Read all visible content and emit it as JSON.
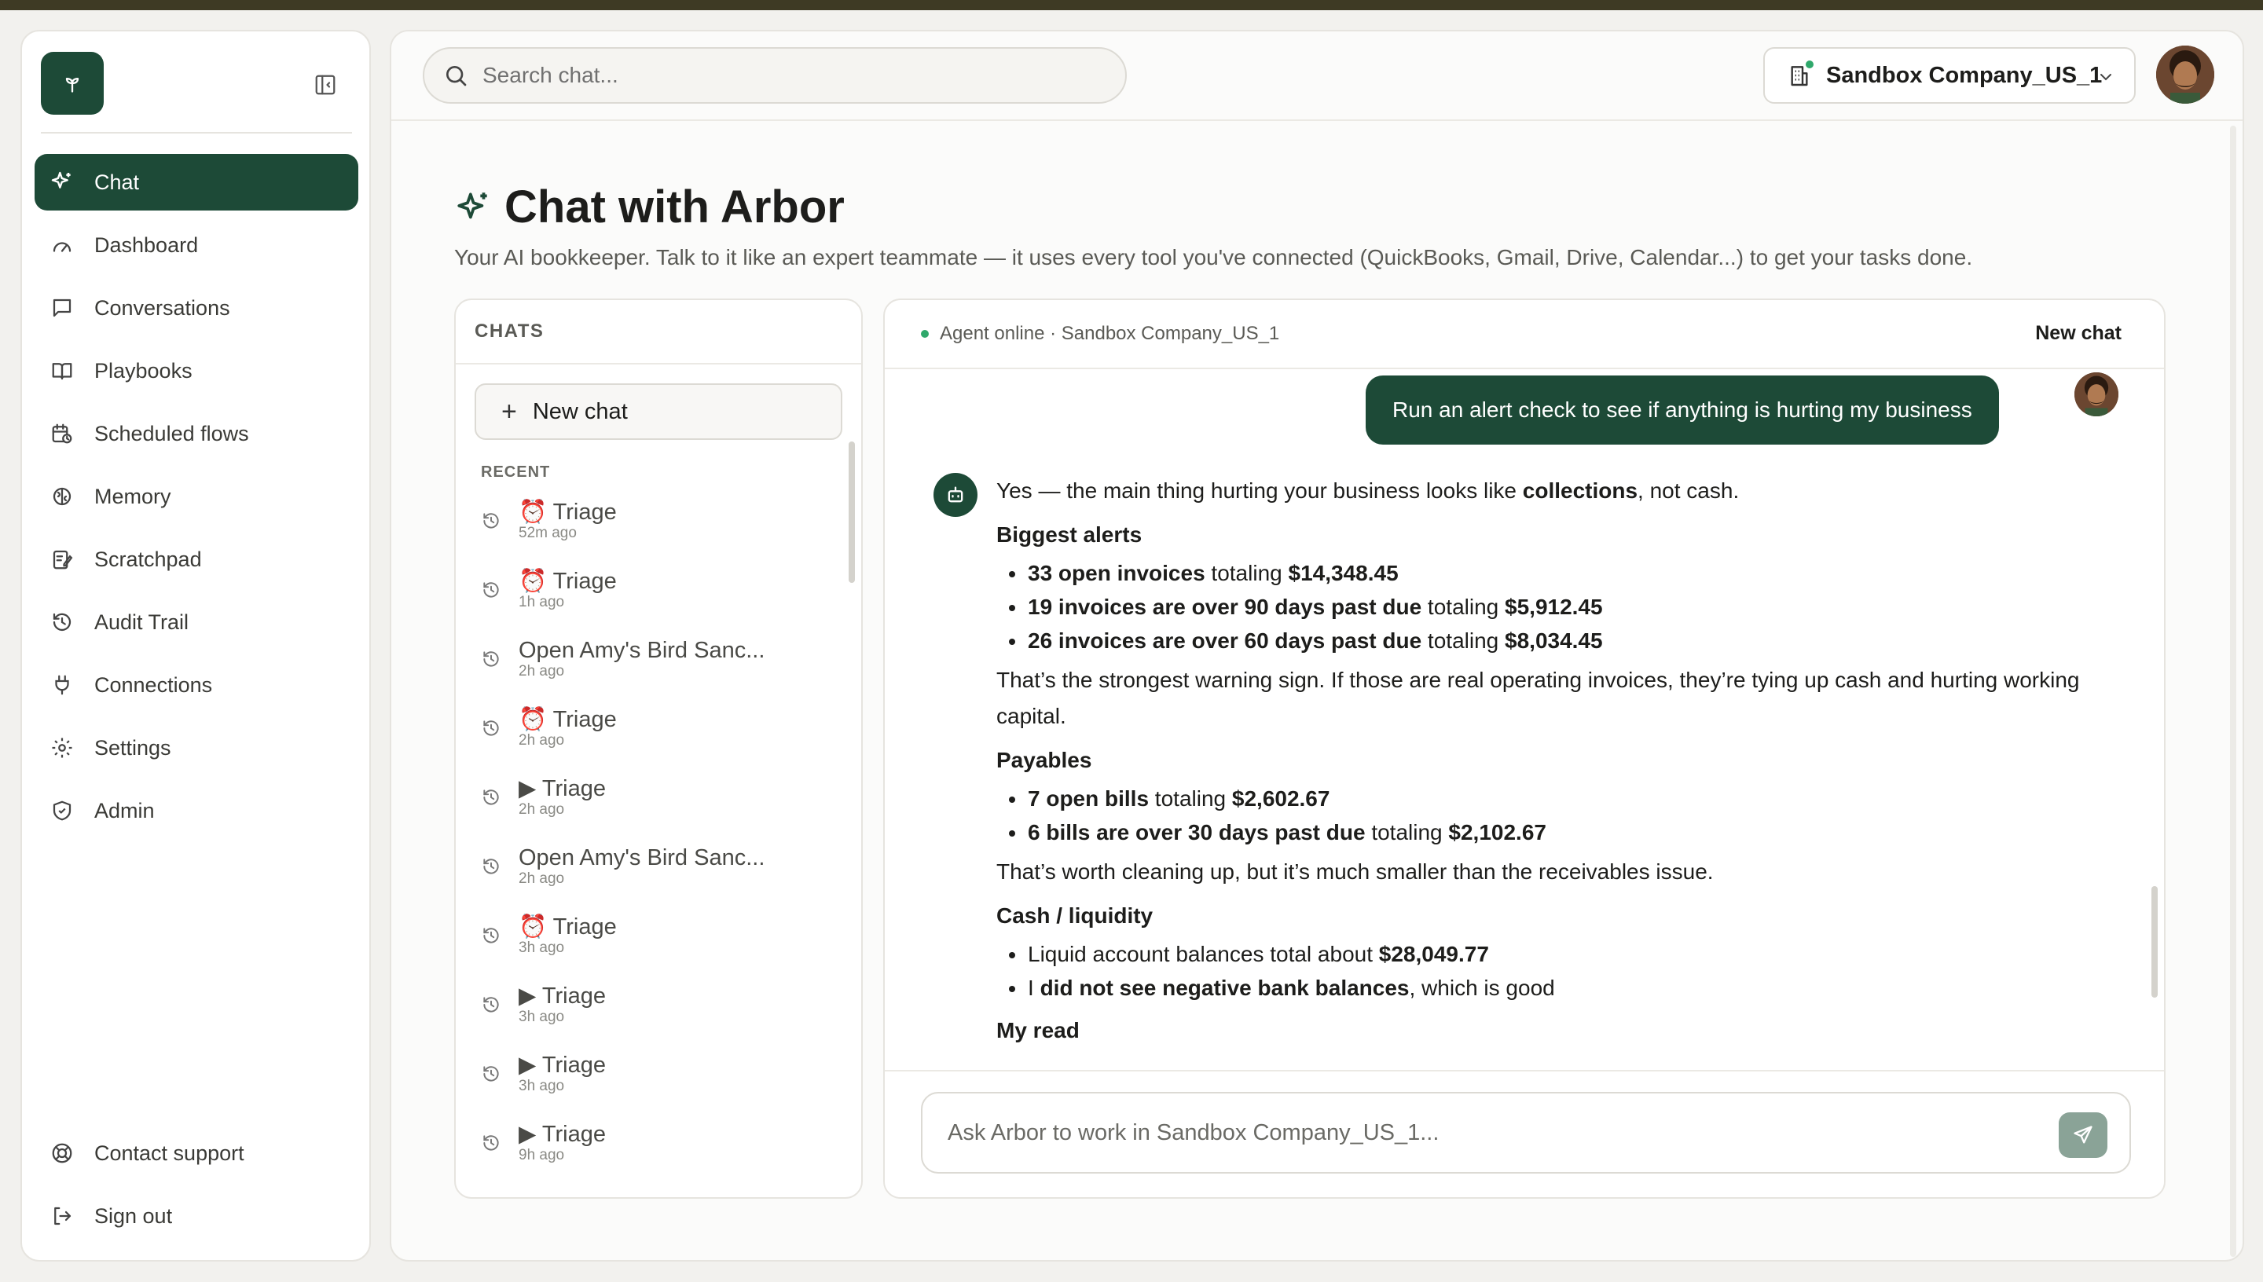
{
  "sidebar": {
    "logo_icon": "sprout-icon",
    "items": [
      {
        "label": "Chat",
        "icon": "sparkles-icon",
        "active": true
      },
      {
        "label": "Dashboard",
        "icon": "gauge-icon"
      },
      {
        "label": "Conversations",
        "icon": "message-icon"
      },
      {
        "label": "Playbooks",
        "icon": "book-icon"
      },
      {
        "label": "Scheduled flows",
        "icon": "calendar-clock-icon"
      },
      {
        "label": "Memory",
        "icon": "brain-icon"
      },
      {
        "label": "Scratchpad",
        "icon": "notepad-icon"
      },
      {
        "label": "Audit Trail",
        "icon": "history-icon"
      },
      {
        "label": "Connections",
        "icon": "plug-icon"
      },
      {
        "label": "Settings",
        "icon": "gear-icon"
      },
      {
        "label": "Admin",
        "icon": "shield-icon"
      }
    ],
    "bottom": [
      {
        "label": "Contact support",
        "icon": "lifebuoy-icon"
      },
      {
        "label": "Sign out",
        "icon": "sign-out-icon"
      }
    ]
  },
  "header": {
    "search_placeholder": "Search chat...",
    "company_name": "Sandbox Company_US_1"
  },
  "page": {
    "title": "Chat with Arbor",
    "subtitle": "Your AI bookkeeper. Talk to it like an expert teammate — it uses every tool you've connected (QuickBooks, Gmail, Drive, Calendar...) to get your tasks done."
  },
  "chats": {
    "header": "CHATS",
    "new_chat_label": "New chat",
    "recent_label": "RECENT",
    "items": [
      {
        "title": "⏰ Triage",
        "time": "52m ago"
      },
      {
        "title": "⏰ Triage",
        "time": "1h ago"
      },
      {
        "title": "Open Amy's Bird Sanc...",
        "time": "2h ago"
      },
      {
        "title": "⏰ Triage",
        "time": "2h ago"
      },
      {
        "title": "▶ Triage",
        "time": "2h ago"
      },
      {
        "title": "Open Amy's Bird Sanc...",
        "time": "2h ago"
      },
      {
        "title": "⏰ Triage",
        "time": "3h ago"
      },
      {
        "title": "▶ Triage",
        "time": "3h ago"
      },
      {
        "title": "▶ Triage",
        "time": "3h ago"
      },
      {
        "title": "▶ Triage",
        "time": "9h ago"
      }
    ]
  },
  "conversation": {
    "status": "Agent online · Sandbox Company_US_1",
    "new_chat_label": "New chat",
    "user_message": "Run an alert check to see if anything is hurting my business",
    "answer": {
      "intro_a": "Yes — the main thing hurting your business looks like ",
      "intro_b": "collections",
      "intro_c": ", not cash.",
      "h_alerts": "Biggest alerts",
      "a1_b": "33 open invoices",
      "a1_t": " totaling ",
      "a1_v": "$14,348.45",
      "a2_b": "19 invoices are over 90 days past due",
      "a2_t": " totaling ",
      "a2_v": "$5,912.45",
      "a3_b": "26 invoices are over 60 days past due",
      "a3_t": " totaling ",
      "a3_v": "$8,034.45",
      "p_warning": "That’s the strongest warning sign. If those are real operating invoices, they’re tying up cash and hurting working capital.",
      "h_payables": "Payables",
      "p1_b": "7 open bills",
      "p1_t": " totaling ",
      "p1_v": "$2,602.67",
      "p2_b": "6 bills are over 30 days past due",
      "p2_t": " totaling ",
      "p2_v": "$2,102.67",
      "p_payables": "That’s worth cleaning up, but it’s much smaller than the receivables issue.",
      "h_cash": "Cash / liquidity",
      "c1_t": "Liquid account balances total about ",
      "c1_v": "$28,049.77",
      "c2_a": "I ",
      "c2_b": "did not see negative bank balances",
      "c2_c": ", which is good",
      "h_read": "My read"
    },
    "composer_placeholder": "Ask Arbor to work in Sandbox Company_US_1..."
  },
  "colors": {
    "brand": "#1d4a37",
    "online": "#2fa86b"
  }
}
